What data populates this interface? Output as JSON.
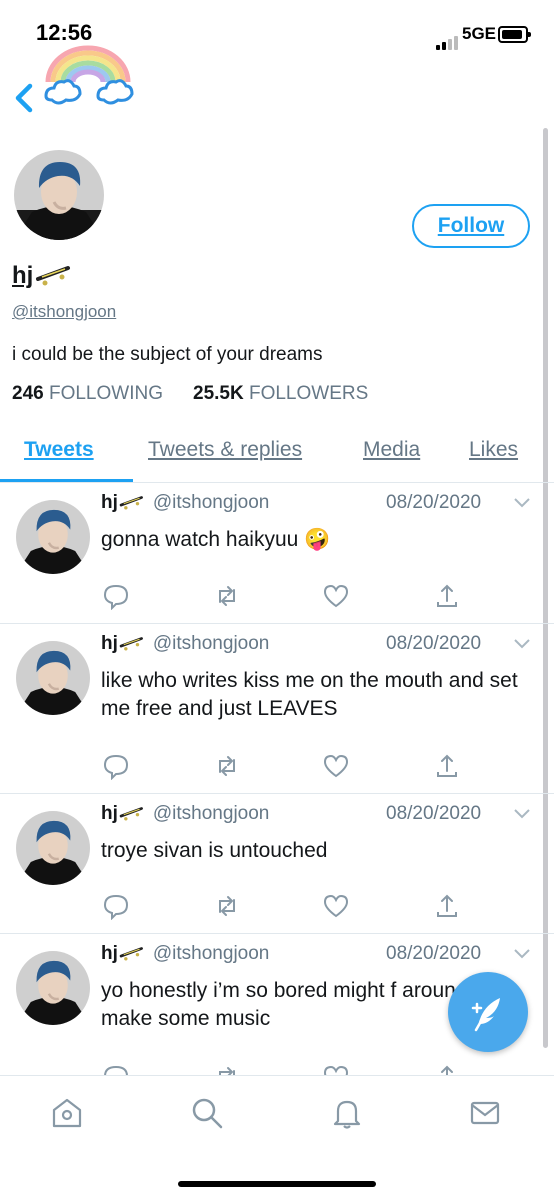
{
  "status_bar": {
    "time": "12:56",
    "network": "5GE"
  },
  "profile": {
    "display_name": "hj",
    "name_emoji": "skateboard-icon",
    "handle": "@itshongjoon",
    "bio": "i could be the subject of your dreams",
    "following_count": "246",
    "following_label": "FOLLOWING",
    "followers_count": "25.5K",
    "followers_label": "FOLLOWERS",
    "follow_label": "Follow"
  },
  "tabs": [
    {
      "label": "Tweets",
      "active": true
    },
    {
      "label": "Tweets & replies",
      "active": false
    },
    {
      "label": "Media",
      "active": false
    },
    {
      "label": "Likes",
      "active": false
    }
  ],
  "tweets": [
    {
      "name": "hj",
      "handle": "@itshongjoon",
      "date": "08/20/2020",
      "text": "gonna watch haikyuu 🤪"
    },
    {
      "name": "hj",
      "handle": "@itshongjoon",
      "date": "08/20/2020",
      "text": "like who writes kiss me on the mouth and set me free and just LEAVES"
    },
    {
      "name": "hj",
      "handle": "@itshongjoon",
      "date": "08/20/2020",
      "text": "troye sivan is untouched"
    },
    {
      "name": "hj",
      "handle": "@itshongjoon",
      "date": "08/20/2020",
      "text": "yo honestly i’m so bored might f around and make some music"
    }
  ],
  "icons": {
    "back": "chevron-left-icon",
    "compose": "compose-feather-icon",
    "nav": [
      "home-icon",
      "search-icon",
      "notifications-icon",
      "messages-icon"
    ]
  },
  "colors": {
    "accent": "#1da1f2",
    "muted": "#657786",
    "fab": "#4aa8ec"
  }
}
